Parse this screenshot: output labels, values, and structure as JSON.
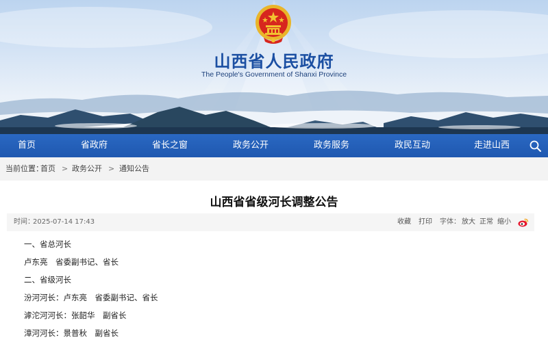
{
  "site": {
    "title": "山西省人民政府",
    "subtitle": "The People's Government of Shanxi Province"
  },
  "colors": {
    "nav_background": "#1f58b0",
    "title_blue": "#1b4fa2",
    "emblem_red": "#d7261e",
    "emblem_gold": "#f2c230"
  },
  "icons": {
    "emblem": "national-emblem-icon",
    "search": "search-icon",
    "weibo": "weibo-icon"
  },
  "nav": {
    "items": [
      "首页",
      "省政府",
      "省长之窗",
      "政务公开",
      "政务服务",
      "政民互动",
      "走进山西"
    ]
  },
  "breadcrumb": {
    "prefix": "当前位置：",
    "items": [
      "首页",
      "政务公开",
      "通知公告"
    ],
    "separator": ">"
  },
  "article": {
    "title": "山西省省级河长调整公告",
    "time_label": "时间：",
    "time_value": "2025-07-14 17:43",
    "actions": {
      "favorite": "收藏",
      "print": "打印",
      "font_label": "字体：",
      "font_large": "放大",
      "font_normal": "正常",
      "font_small": "缩小"
    },
    "paragraphs": [
      "一、省总河长",
      "卢东亮　省委副书记、省长",
      "二、省级河长",
      "汾河河长：卢东亮　省委副书记、省长",
      "滹沱河河长：张韶华　副省长",
      "漳河河长：景普秋　副省长"
    ]
  }
}
